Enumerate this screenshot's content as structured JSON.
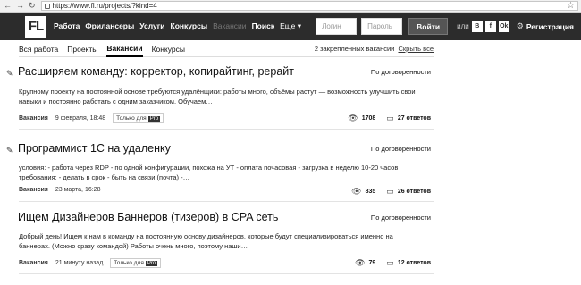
{
  "browser": {
    "url": "https://www.fl.ru/projects/?kind=4"
  },
  "header": {
    "logo": "FL",
    "menu": [
      "Работа",
      "Фрилансеры",
      "Услуги",
      "Конкурсы"
    ],
    "menu_dim": "Вакансии",
    "search": "Поиск",
    "more": "Еще ▾",
    "login_placeholder": "Логин",
    "password_placeholder": "Пароль",
    "enter": "Войти",
    "or": "или",
    "social": [
      "В",
      "f",
      "Ok"
    ],
    "register": "Регистрация"
  },
  "tabs": {
    "items": [
      "Вся работа",
      "Проекты",
      "Вакансии",
      "Конкурсы"
    ],
    "pinned": "2 закрепленных вакансии",
    "hide": "Скрыть все"
  },
  "jobs": [
    {
      "title": "Расширяем команду: корректор, копирайтинг, рерайт",
      "budget": "По договоренности",
      "desc": "Крупному проекту на постоянной основе требуются удалёнщики: работы много, объёмы растут — возможность улучшить свои навыки и постоянно работать с одним заказчиком. Обучаем…",
      "type": "Вакансия",
      "date": "9 февраля, 18:48",
      "only_for": "Только для",
      "pro": "Pro",
      "views": "1708",
      "answers": "27 ответов"
    },
    {
      "title": "Программист 1С на удаленку",
      "budget": "По договоренности",
      "desc": "условия: - работа через RDP - по одной конфигурации, похожа на УТ - оплата почасовая - загрузка в неделю 10-20 часов требования: - делать в срок - быть на связи (почта) -…",
      "type": "Вакансия",
      "date": "23 марта, 16:28",
      "views": "835",
      "answers": "26 ответов"
    },
    {
      "title": "Ищем Дизайнеров Баннеров (тизеров) в CPA сеть",
      "budget": "По договоренности",
      "desc": "Добрый день! Ищем к нам в команду на постоянную основу дизайнеров, которые будут специализироваться именно на баннерах. (Можно сразу командой) Работы очень много, поэтому наши…",
      "type": "Вакансия",
      "date": "21 минуту назад",
      "only_for": "Только для",
      "pro": "Pro",
      "views": "79",
      "answers": "12 ответов"
    }
  ]
}
